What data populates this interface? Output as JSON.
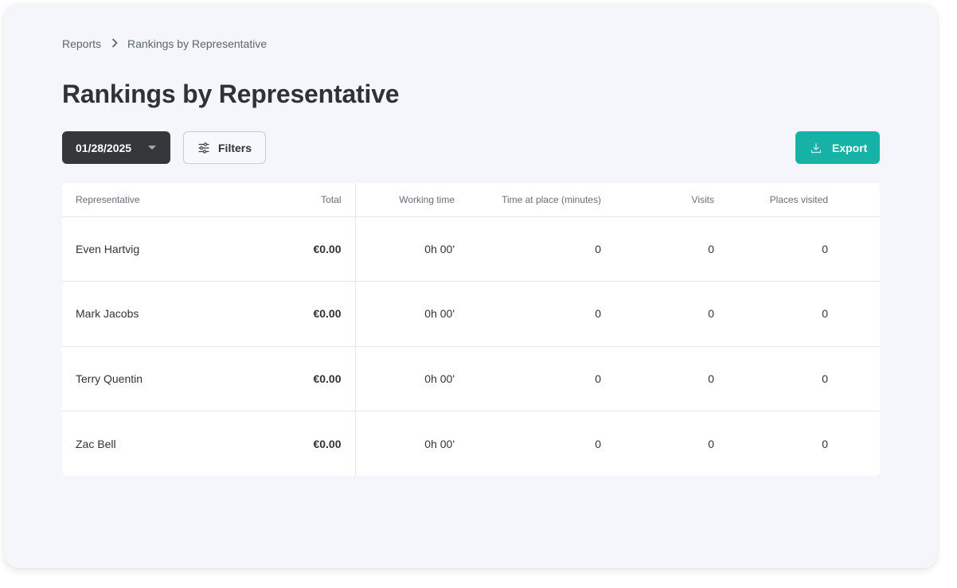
{
  "breadcrumb": {
    "parent": "Reports",
    "current": "Rankings by Representative"
  },
  "page": {
    "title": "Rankings by Representative"
  },
  "toolbar": {
    "date_value": "01/28/2025",
    "filters_label": "Filters",
    "export_label": "Export"
  },
  "colors": {
    "accent": "#17b2a6",
    "date_button_bg": "#35383b",
    "page_bg": "#f4f6fb"
  },
  "icons": {
    "breadcrumb_separator": "chevron-right-icon",
    "date_dropdown": "caret-down-icon",
    "filters": "sliders-icon",
    "export": "download-icon"
  },
  "table": {
    "columns": [
      "Representative",
      "Total",
      "Working time",
      "Time at place (minutes)",
      "Visits",
      "Places visited"
    ],
    "rows": [
      {
        "representative": "Even Hartvig",
        "total": "€0.00",
        "working_time": "0h 00'",
        "time_at_place": "0",
        "visits": "0",
        "places_visited": "0"
      },
      {
        "representative": "Mark Jacobs",
        "total": "€0.00",
        "working_time": "0h 00'",
        "time_at_place": "0",
        "visits": "0",
        "places_visited": "0"
      },
      {
        "representative": "Terry Quentin",
        "total": "€0.00",
        "working_time": "0h 00'",
        "time_at_place": "0",
        "visits": "0",
        "places_visited": "0"
      },
      {
        "representative": "Zac Bell",
        "total": "€0.00",
        "working_time": "0h 00'",
        "time_at_place": "0",
        "visits": "0",
        "places_visited": "0"
      }
    ]
  }
}
